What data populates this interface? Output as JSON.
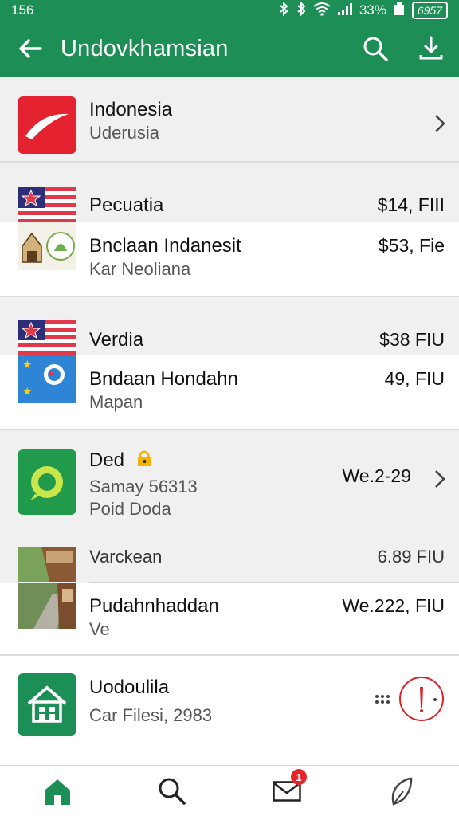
{
  "status": {
    "time": "156",
    "battery": "33%",
    "battery_badge": "6957"
  },
  "appbar": {
    "title": "Undovkhamsian"
  },
  "items": [
    {
      "title": "Indonesia",
      "subtitle": "Uderusia"
    },
    {
      "title": "Pecuatia",
      "amount": "$14, FIII"
    },
    {
      "title": "Bnclaan Indanesit",
      "subtitle": "Kar Neoliana",
      "amount": "$53, Fie"
    },
    {
      "title": "Verdia",
      "amount": "$38  FIU"
    },
    {
      "title": "Bndaan Hondahn",
      "subtitle": "Mapan",
      "amount": "49, FIU"
    },
    {
      "title": "Ded",
      "subtitle": "Samay 56313",
      "subtitle2": "Poid Doda",
      "amount": "We.2-29"
    },
    {
      "title": "Varckean",
      "amount": "6.89  FIU"
    },
    {
      "title": "Pudahnhaddan",
      "subtitle": "Ve",
      "amount": "We.222, FIU"
    },
    {
      "title": "Uodoulila",
      "subtitle": "Car Filesi, 2983"
    }
  ],
  "bottom_nav": {
    "messages_badge": "1"
  },
  "icons": [
    "back-arrow-icon",
    "search-icon",
    "download-icon",
    "chevron-right-icon",
    "home-icon",
    "mail-icon",
    "leaf-icon",
    "lock-icon"
  ],
  "colors": {
    "primary": "#1e8e57",
    "accent_red": "#e4262c"
  }
}
